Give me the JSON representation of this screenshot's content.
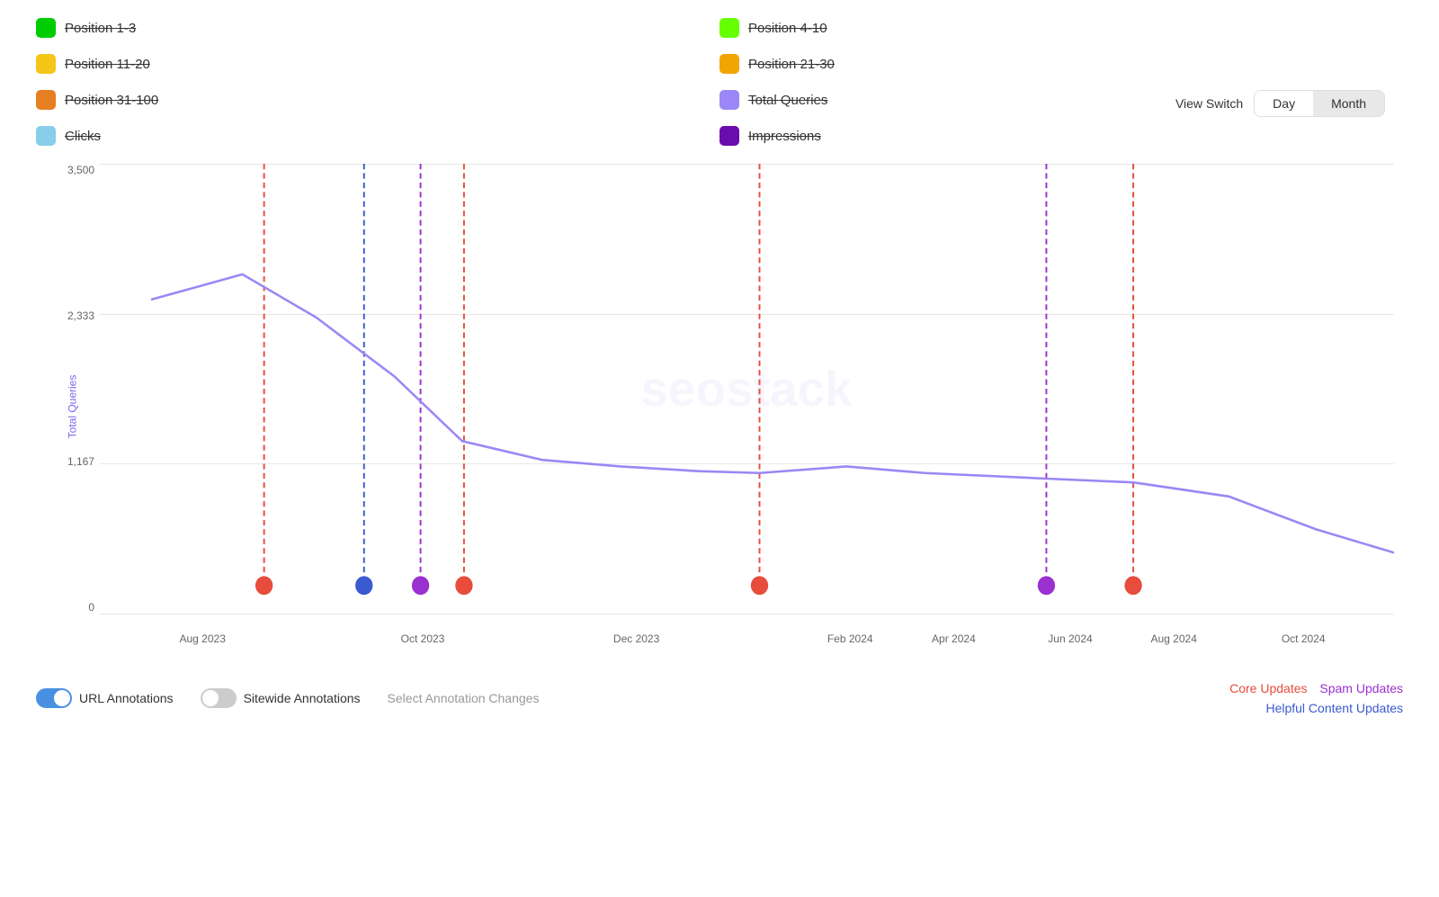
{
  "legend": {
    "left": [
      {
        "id": "pos1-3",
        "label": "Position 1-3",
        "color": "#00cc00",
        "strikethrough": true
      },
      {
        "id": "pos11-20",
        "label": "Position 11-20",
        "color": "#f5c518",
        "strikethrough": true
      },
      {
        "id": "pos31-100",
        "label": "Position 31-100",
        "color": "#e67e22",
        "strikethrough": true
      },
      {
        "id": "clicks",
        "label": "Clicks",
        "color": "#87ceeb",
        "strikethrough": true
      }
    ],
    "right": [
      {
        "id": "pos4-10",
        "label": "Position 4-10",
        "color": "#66ff00",
        "strikethrough": true
      },
      {
        "id": "pos21-30",
        "label": "Position 21-30",
        "color": "#f0a500",
        "strikethrough": true
      },
      {
        "id": "total-queries",
        "label": "Total Queries",
        "color": "#9b87f5",
        "strikethrough": false
      },
      {
        "id": "impressions",
        "label": "Impressions",
        "color": "#6a0dad",
        "strikethrough": true
      }
    ]
  },
  "viewSwitch": {
    "label": "View Switch",
    "options": [
      "Day",
      "Month"
    ],
    "active": "Month"
  },
  "chart": {
    "yAxis": {
      "label": "Total Queries",
      "ticks": [
        "3,500",
        "2,333",
        "1,167",
        "0"
      ]
    },
    "xAxis": {
      "ticks": [
        "Aug 2023",
        "Oct 2023",
        "Dec 2023",
        "Feb 2024",
        "Apr 2024",
        "Jun 2024",
        "Aug 2024",
        "Oct 2024"
      ]
    },
    "watermark": "seostack"
  },
  "bottomControls": {
    "urlAnnotations": {
      "label": "URL Annotations",
      "on": true
    },
    "sitewideAnnotations": {
      "label": "Sitewide Annotations",
      "on": false
    },
    "selectAnnotations": "Select Annotation Changes",
    "coreUpdates": "Core Updates",
    "spamUpdates": "Spam Updates",
    "helpfulContentUpdates": "Helpful Content Updates"
  }
}
